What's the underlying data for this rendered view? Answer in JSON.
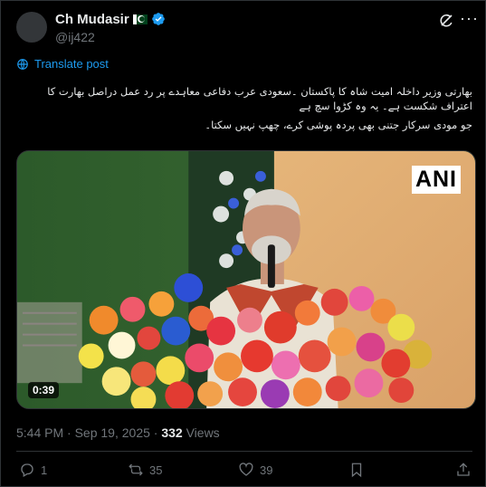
{
  "author": {
    "display_name": "Ch Mudasir",
    "flag_icon": "pakistan-flag-icon",
    "verified_icon": "verified-badge-icon",
    "handle": "@ij422"
  },
  "translate": {
    "label": "Translate post"
  },
  "post": {
    "line1": "بھارتی وزیر داخلہ امیت شاہ کا پاکستان ۔سعودی عرب دفاعی معاہدے پر رد عمل دراصل بھارت کا اعتراف شکست ہے۔ یہ وہ کڑوا سچ ہے",
    "line2": "جو مودی سرکار جتنی بھی پردہ پوشی کرے، چھپ نہیں سکتا۔"
  },
  "media": {
    "watermark": "ANI",
    "duration": "0:39"
  },
  "meta": {
    "time": "5:44 PM",
    "separator": "·",
    "date": "Sep 19, 2025",
    "views_count": "332",
    "views_label": "Views"
  },
  "actions": {
    "replies": "1",
    "reposts": "35",
    "likes": "39"
  },
  "colors": {
    "accent": "#1d9bf0",
    "muted": "#71767b",
    "background": "#000000"
  }
}
